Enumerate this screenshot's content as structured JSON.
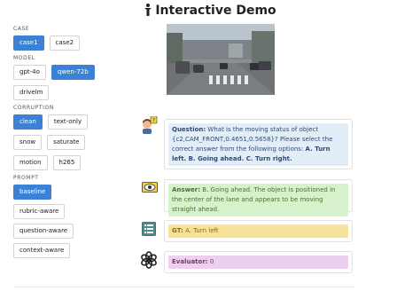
{
  "header": {
    "title": "Interactive Demo",
    "icon": "person-icon"
  },
  "sidebar": {
    "case": {
      "label": "CASE",
      "options": [
        "case1",
        "case2"
      ],
      "selected": "case1"
    },
    "model": {
      "label": "MODEL",
      "options": [
        "gpt-4o",
        "qwen-72b",
        "drivelm"
      ],
      "selected": "qwen-72b"
    },
    "corruption": {
      "label": "CORRUPTION",
      "options": [
        "clean",
        "text-only",
        "snow",
        "saturate",
        "motion",
        "h265"
      ],
      "selected": "clean"
    },
    "prompt": {
      "label": "PROMPT",
      "options": [
        "baseline",
        "rubric-aware",
        "question-aware",
        "context-aware"
      ],
      "selected": "baseline"
    }
  },
  "question": {
    "icon": "question-user-icon",
    "label": "Question:",
    "text": "What is the moving status of object {c2,CAM_FRONT,0.4651,0.5658}? Please select the correct answer from the following options:",
    "options": "A. Turn left. B. Going ahead. C. Turn right."
  },
  "answer": {
    "icon": "eye-icon",
    "label": "Answer:",
    "text": "B. Going ahead. The object is positioned in the center of the lane and appears to be moving straight ahead."
  },
  "gt": {
    "icon": "list-icon",
    "label": "GT:",
    "text": "A. Turn left"
  },
  "evaluator": {
    "icon": "openai-icon",
    "label": "Evaluator:",
    "text": "0"
  },
  "colors": {
    "accent": "#3b82d6",
    "question_bg": "#e3edf7",
    "answer_bg": "#d6f1cc",
    "gt_bg": "#f7e29a",
    "eval_bg": "#edd0ef"
  }
}
